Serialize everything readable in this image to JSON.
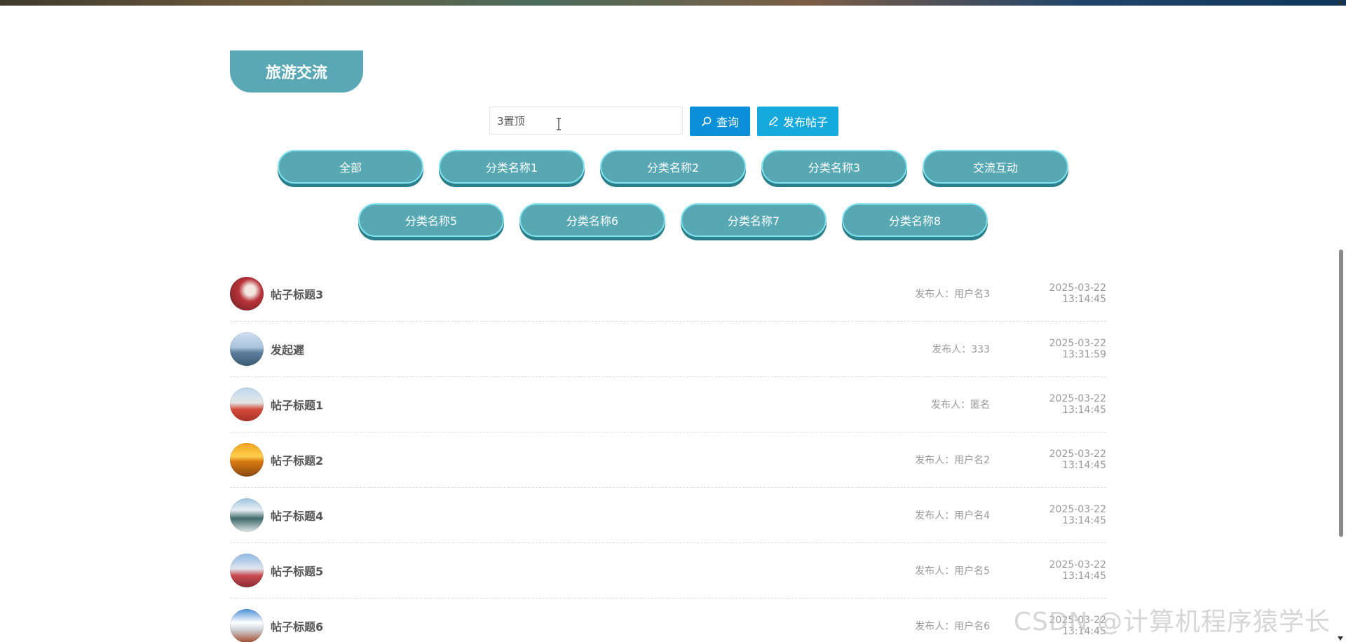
{
  "section": {
    "title": "旅游交流"
  },
  "search": {
    "value": "3置顶",
    "query_label": "查询",
    "post_label": "发布帖子"
  },
  "categories": [
    "全部",
    "分类名称1",
    "分类名称2",
    "分类名称3",
    "交流互动",
    "分类名称5",
    "分类名称6",
    "分类名称7",
    "分类名称8"
  ],
  "posts": [
    {
      "title": "帖子标题3",
      "author": "发布人：用户名3",
      "time": "2025-03-22 13:14:45"
    },
    {
      "title": "发起遲",
      "author": "发布人：333",
      "time": "2025-03-22 13:31:59"
    },
    {
      "title": "帖子标题1",
      "author": "发布人：匿名",
      "time": "2025-03-22 13:14:45"
    },
    {
      "title": "帖子标题2",
      "author": "发布人：用户名2",
      "time": "2025-03-22 13:14:45"
    },
    {
      "title": "帖子标题4",
      "author": "发布人：用户名4",
      "time": "2025-03-22 13:14:45"
    },
    {
      "title": "帖子标题5",
      "author": "发布人：用户名5",
      "time": "2025-03-22 13:14:45"
    },
    {
      "title": "帖子标题6",
      "author": "发布人：用户名6",
      "time": "2025-03-22 13:14:45"
    }
  ],
  "watermark": "CSDN @计算机程序猿学长",
  "colors": {
    "accent": "#5aa8b6",
    "query_button": "#0b8fd8",
    "post_button": "#15a9dc"
  }
}
